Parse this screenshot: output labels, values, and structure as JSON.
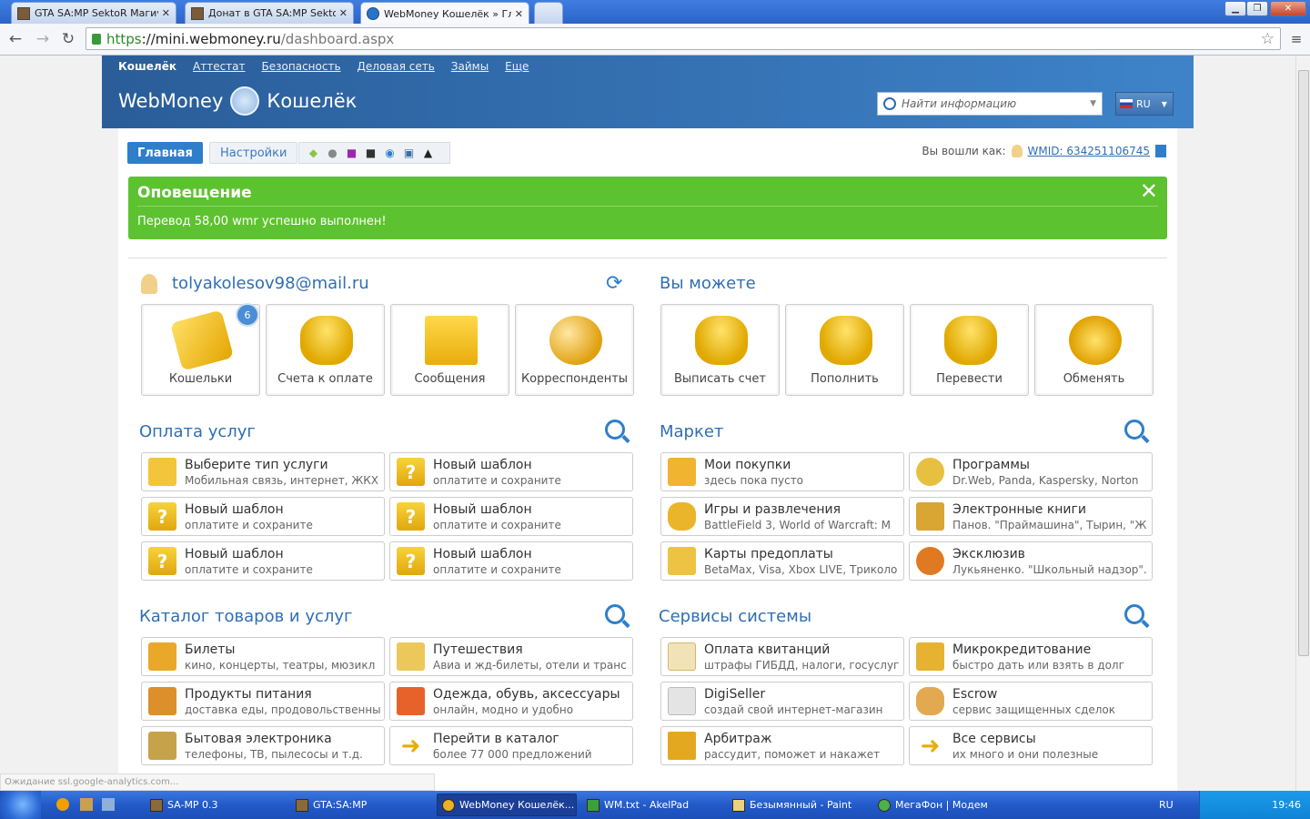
{
  "browser": {
    "tabs": [
      {
        "title": "GTA SA:MP SektoR Магичес"
      },
      {
        "title": "Донат в GTA SA:MP Sektor"
      },
      {
        "title": "WebMoney Кошелёк » Глав"
      }
    ],
    "url_https": "https",
    "url_host": "://mini.webmoney.ru",
    "url_path": "/dashboard.aspx"
  },
  "header": {
    "nav": [
      "Кошелёк",
      "Аттестат",
      "Безопасность",
      "Деловая сеть",
      "Займы",
      "Еще"
    ],
    "logo_brand": "WebMoney",
    "logo_product": "Кошелёк",
    "search_placeholder": "Найти информацию",
    "lang": "RU"
  },
  "toolbar": {
    "tab_main": "Главная",
    "tab_settings": "Настройки",
    "logged_as": "Вы вошли как:",
    "wmid": "WMID: 634251106745"
  },
  "alert": {
    "title": "Оповещение",
    "message": "Перевод 58,00 wmr успешно выполнен!"
  },
  "account": {
    "email": "tolyakolesov98@mail.ru",
    "tiles": [
      {
        "label": "Кошельки",
        "badge": "6"
      },
      {
        "label": "Счета к оплате"
      },
      {
        "label": "Сообщения"
      },
      {
        "label": "Корреспонденты"
      }
    ]
  },
  "you_can": {
    "title": "Вы можете",
    "tiles": [
      {
        "label": "Выписать счет"
      },
      {
        "label": "Пополнить"
      },
      {
        "label": "Перевести"
      },
      {
        "label": "Обменять"
      }
    ]
  },
  "services": {
    "title": "Оплата услуг",
    "items": [
      {
        "title": "Выберите тип услуги",
        "sub": "Мобильная связь, интернет, ЖКХ"
      },
      {
        "title": "Новый шаблон",
        "sub": "оплатите и сохраните"
      },
      {
        "title": "Новый шаблон",
        "sub": "оплатите и сохраните"
      },
      {
        "title": "Новый шаблон",
        "sub": "оплатите и сохраните"
      },
      {
        "title": "Новый шаблон",
        "sub": "оплатите и сохраните"
      },
      {
        "title": "Новый шаблон",
        "sub": "оплатите и сохраните"
      }
    ]
  },
  "market": {
    "title": "Маркет",
    "items": [
      {
        "title": "Мои покупки",
        "sub": "здесь пока пусто"
      },
      {
        "title": "Программы",
        "sub": "Dr.Web, Panda, Kaspersky, Norton"
      },
      {
        "title": "Игры и развлечения",
        "sub": "BattleField 3, World of Warcraft: M"
      },
      {
        "title": "Электронные книги",
        "sub": "Панов. \"Праймашина\", Тырин, \"Ж"
      },
      {
        "title": "Карты предоплаты",
        "sub": "BetaMax, Visa, Xbox LIVE, Триколо"
      },
      {
        "title": "Эксклюзив",
        "sub": "Лукьяненко. \"Школьный надзор\"."
      }
    ]
  },
  "catalog": {
    "title": "Каталог товаров и услуг",
    "items": [
      {
        "title": "Билеты",
        "sub": "кино, концерты, театры, мюзикл"
      },
      {
        "title": "Путешествия",
        "sub": "Авиа и жд-билеты, отели и транс"
      },
      {
        "title": "Продукты питания",
        "sub": "доставка еды, продовольственны"
      },
      {
        "title": "Одежда, обувь, аксессуары",
        "sub": "онлайн, модно и удобно"
      },
      {
        "title": "Бытовая электроника",
        "sub": "телефоны, ТВ, пылесосы и т.д."
      },
      {
        "title": "Перейти в каталог",
        "sub": "более 77 000 предложений"
      }
    ]
  },
  "system": {
    "title": "Сервисы системы",
    "items": [
      {
        "title": "Оплата квитанций",
        "sub": "штрафы ГИБДД, налоги, госуслуг"
      },
      {
        "title": "Микрокредитование",
        "sub": "быстро дать или взять в долг"
      },
      {
        "title": "DigiSeller",
        "sub": "создай свой интернет-магазин"
      },
      {
        "title": "Escrow",
        "sub": "сервис защищенных сделок"
      },
      {
        "title": "Арбитраж",
        "sub": "рассудит, поможет и накажет"
      },
      {
        "title": "Все сервисы",
        "sub": "их много и они полезные"
      }
    ]
  },
  "status_bar": "Ожидание ssl.google-analytics.com...",
  "taskbar": {
    "items": [
      "SA-MP 0.3",
      "GTA:SA:MP",
      "WebMoney Кошелёк...",
      "WM.txt - AkelPad",
      "Безымянный - Paint",
      "МегаФон | Модем"
    ],
    "lang": "RU",
    "time": "19:46"
  },
  "colors": {
    "accent": "#2f7ecb",
    "alert": "#5dc22f",
    "header": "#2a5d99"
  }
}
